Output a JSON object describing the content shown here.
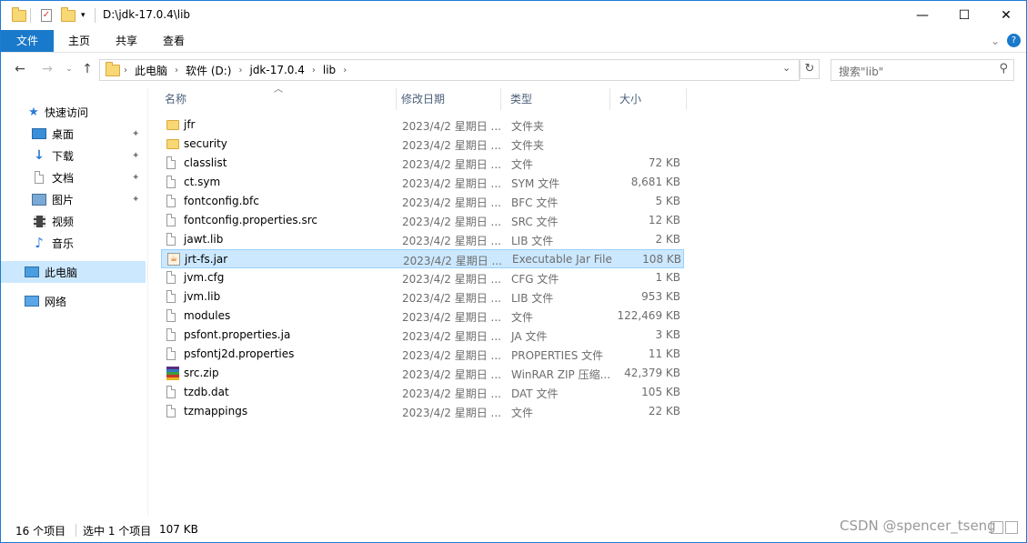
{
  "window": {
    "title": "D:\\jdk-17.0.4\\lib",
    "minimize": "—",
    "maximize": "☐",
    "close": "✕"
  },
  "ribbon": {
    "tabs": [
      "文件",
      "主页",
      "共享",
      "查看"
    ],
    "expand_chevron": "⌄",
    "help": "?"
  },
  "address": {
    "crumbs": [
      "此电脑",
      "软件 (D:)",
      "jdk-17.0.4",
      "lib"
    ],
    "search_placeholder": "搜索\"lib\""
  },
  "sidebar": {
    "items": [
      {
        "label": "快速访问",
        "icon": "star-icon",
        "pinned": false
      },
      {
        "label": "桌面",
        "icon": "desktop-icon",
        "pinned": true
      },
      {
        "label": "下载",
        "icon": "download-icon",
        "pinned": true
      },
      {
        "label": "文档",
        "icon": "documents-icon",
        "pinned": true
      },
      {
        "label": "图片",
        "icon": "pictures-icon",
        "pinned": true
      },
      {
        "label": "视频",
        "icon": "videos-icon",
        "pinned": false
      },
      {
        "label": "音乐",
        "icon": "music-icon",
        "pinned": false
      },
      {
        "label": "此电脑",
        "icon": "computer-icon",
        "pinned": false,
        "selected": true
      },
      {
        "label": "网络",
        "icon": "network-icon",
        "pinned": false
      }
    ]
  },
  "columns": [
    "名称",
    "修改日期",
    "类型",
    "大小"
  ],
  "files": [
    {
      "name": "jfr",
      "date": "2023/4/2 星期日 ...",
      "type": "文件夹",
      "size": "",
      "kind": "folder"
    },
    {
      "name": "security",
      "date": "2023/4/2 星期日 ...",
      "type": "文件夹",
      "size": "",
      "kind": "folder"
    },
    {
      "name": "classlist",
      "date": "2023/4/2 星期日 ...",
      "type": "文件",
      "size": "72 KB",
      "kind": "doc"
    },
    {
      "name": "ct.sym",
      "date": "2023/4/2 星期日 ...",
      "type": "SYM 文件",
      "size": "8,681 KB",
      "kind": "doc"
    },
    {
      "name": "fontconfig.bfc",
      "date": "2023/4/2 星期日 ...",
      "type": "BFC 文件",
      "size": "5 KB",
      "kind": "doc"
    },
    {
      "name": "fontconfig.properties.src",
      "date": "2023/4/2 星期日 ...",
      "type": "SRC 文件",
      "size": "12 KB",
      "kind": "doc"
    },
    {
      "name": "jawt.lib",
      "date": "2023/4/2 星期日 ...",
      "type": "LIB 文件",
      "size": "2 KB",
      "kind": "doc"
    },
    {
      "name": "jrt-fs.jar",
      "date": "2023/4/2 星期日 ...",
      "type": "Executable Jar File",
      "size": "108 KB",
      "kind": "jar",
      "selected": true
    },
    {
      "name": "jvm.cfg",
      "date": "2023/4/2 星期日 ...",
      "type": "CFG 文件",
      "size": "1 KB",
      "kind": "doc"
    },
    {
      "name": "jvm.lib",
      "date": "2023/4/2 星期日 ...",
      "type": "LIB 文件",
      "size": "953 KB",
      "kind": "doc"
    },
    {
      "name": "modules",
      "date": "2023/4/2 星期日 ...",
      "type": "文件",
      "size": "122,469 KB",
      "kind": "doc"
    },
    {
      "name": "psfont.properties.ja",
      "date": "2023/4/2 星期日 ...",
      "type": "JA 文件",
      "size": "3 KB",
      "kind": "doc"
    },
    {
      "name": "psfontj2d.properties",
      "date": "2023/4/2 星期日 ...",
      "type": "PROPERTIES 文件",
      "size": "11 KB",
      "kind": "doc"
    },
    {
      "name": "src.zip",
      "date": "2023/4/2 星期日 ...",
      "type": "WinRAR ZIP 压缩...",
      "size": "42,379 KB",
      "kind": "zip"
    },
    {
      "name": "tzdb.dat",
      "date": "2023/4/2 星期日 ...",
      "type": "DAT 文件",
      "size": "105 KB",
      "kind": "doc"
    },
    {
      "name": "tzmappings",
      "date": "2023/4/2 星期日 ...",
      "type": "文件",
      "size": "22 KB",
      "kind": "doc"
    }
  ],
  "status": {
    "count": "16 个项目",
    "selected": "选中 1 个项目",
    "selected_size": "107 KB"
  },
  "watermark": "CSDN @spencer_tseng"
}
